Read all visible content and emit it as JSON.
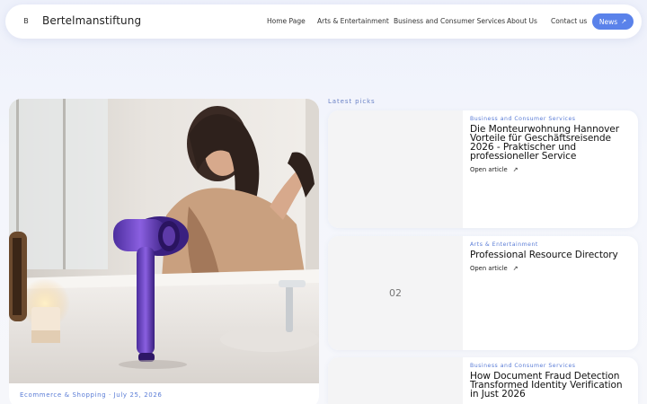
{
  "header": {
    "logo_letter": "B",
    "brand": "Bertelmanstiftung",
    "nav": [
      "Home Page",
      "Arts & Entertainment",
      "Business and Consumer Services",
      "About Us",
      "Contact us"
    ],
    "news_button": "News",
    "news_icon": "arrow-up-right-icon"
  },
  "hero": {
    "image_icon": "hair-dryer-photo",
    "meta": "Ecommerce & Shopping  ·  July 25, 2026"
  },
  "picks": {
    "label": "Latest picks",
    "items": [
      {
        "category": "Business and Consumer Services",
        "title": "Die Monteurwohnung Hannover Vorteile für Geschäftsreisende 2026 - Praktischer und professioneller Service",
        "link": "Open article",
        "thumb": ""
      },
      {
        "category": "Arts & Entertainment",
        "title": "Professional Resource Directory",
        "link": "Open article",
        "thumb": "02"
      },
      {
        "category": "Business and Consumer Services",
        "title": "How Document Fraud Detection Transformed Identity Verification in Just 2026",
        "link": "",
        "thumb": ""
      }
    ]
  }
}
